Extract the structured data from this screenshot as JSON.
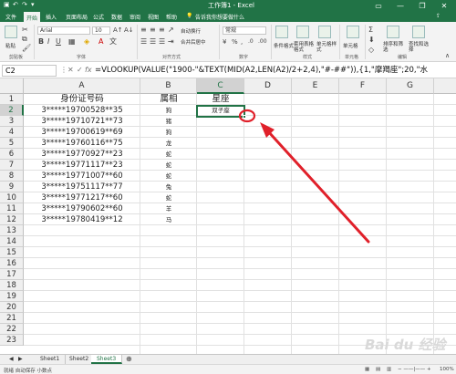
{
  "window": {
    "title": "工作簿1 - Excel",
    "minimize": "—",
    "restore": "❐",
    "close": "✕"
  },
  "ribbon_tabs": [
    {
      "label": "文件"
    },
    {
      "label": "开始"
    },
    {
      "label": "插入"
    },
    {
      "label": "页面布局"
    },
    {
      "label": "公式"
    },
    {
      "label": "数据"
    },
    {
      "label": "审阅"
    },
    {
      "label": "视图"
    },
    {
      "label": "帮助"
    }
  ],
  "tell_me": "告诉我你想要做什么",
  "ribbon": {
    "font_name": "Arial",
    "font_size": "10",
    "groups": [
      "剪贴板",
      "字体",
      "对齐方式",
      "数字",
      "样式",
      "单元格",
      "编辑"
    ],
    "items": {
      "paste": "粘贴",
      "wrap": "自动换行",
      "merge": "合并后居中",
      "number_format": "常规",
      "cond_format": "条件格式",
      "table_format": "套用表格格式",
      "cell_style": "单元格样式",
      "cells": "单元格",
      "sort": "排序和筛选",
      "find": "查找和选择"
    }
  },
  "formula_bar": {
    "name_box": "C2",
    "fx": "fx",
    "formula": "=VLOOKUP(VALUE(\"1900-\"&TEXT(MID(A2,LEN(A2)/2+2,4),\"#-##\")),{1,\"摩羯座\";20,\"水"
  },
  "columns": [
    "A",
    "B",
    "C",
    "D",
    "E",
    "F",
    "G"
  ],
  "rows": [
    "1",
    "2",
    "3",
    "4",
    "5",
    "6",
    "7",
    "8",
    "9",
    "10",
    "11",
    "12",
    "13",
    "14",
    "15",
    "16",
    "17",
    "18",
    "19",
    "20",
    "21",
    "22",
    "23"
  ],
  "headers": {
    "A": "身份证号码",
    "B": "属相",
    "C": "星座"
  },
  "data": [
    {
      "id": "3*****19700528**35",
      "zodiac": "狗",
      "star": "双子座"
    },
    {
      "id": "3*****19710721**73",
      "zodiac": "猪",
      "star": ""
    },
    {
      "id": "3*****19700619**69",
      "zodiac": "狗",
      "star": ""
    },
    {
      "id": "3*****19760116**75",
      "zodiac": "龙",
      "star": ""
    },
    {
      "id": "3*****19770927**23",
      "zodiac": "蛇",
      "star": ""
    },
    {
      "id": "3*****19771117**23",
      "zodiac": "蛇",
      "star": ""
    },
    {
      "id": "3*****19771007**60",
      "zodiac": "蛇",
      "star": ""
    },
    {
      "id": "3*****19751117**77",
      "zodiac": "兔",
      "star": ""
    },
    {
      "id": "3*****19771217**60",
      "zodiac": "蛇",
      "star": ""
    },
    {
      "id": "3*****19790602**60",
      "zodiac": "羊",
      "star": ""
    },
    {
      "id": "3*****19780419**12",
      "zodiac": "马",
      "star": ""
    }
  ],
  "sheets": [
    {
      "label": "Sheet1",
      "active": false
    },
    {
      "label": "Sheet2",
      "active": false
    },
    {
      "label": "Sheet3",
      "active": true
    }
  ],
  "status": {
    "left": "就绪  自动保存 小数点",
    "zoom": "100%"
  },
  "watermark": "Bai du 经验",
  "colors": {
    "excel_green": "#217346",
    "annotation_red": "#e0202a"
  }
}
